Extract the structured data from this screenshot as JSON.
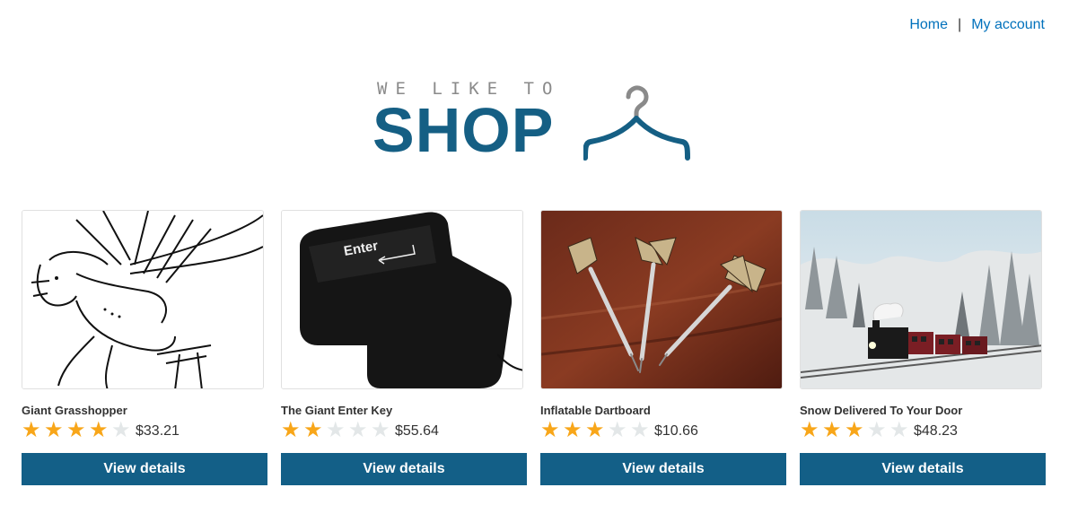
{
  "nav": {
    "home_label": "Home",
    "separator": "|",
    "account_label": "My account"
  },
  "logo": {
    "tagline": "WE LIKE TO",
    "wordmark": "SHOP",
    "icon": "hanger-icon"
  },
  "colors": {
    "brand": "#135f87",
    "link": "#0071bc",
    "star_on": "#f8a619",
    "star_off": "#e3e7e8"
  },
  "products": [
    {
      "name": "Giant Grasshopper",
      "rating": 4,
      "max_rating": 5,
      "price": "$33.21",
      "button_label": "View details",
      "image": "grasshopper-sketch"
    },
    {
      "name": "The Giant Enter Key",
      "rating": 2,
      "max_rating": 5,
      "price": "$55.64",
      "button_label": "View details",
      "image": "enter-key-cushion"
    },
    {
      "name": "Inflatable Dartboard",
      "rating": 3,
      "max_rating": 5,
      "price": "$10.66",
      "button_label": "View details",
      "image": "darts-on-table"
    },
    {
      "name": "Snow Delivered To Your Door",
      "rating": 3,
      "max_rating": 5,
      "price": "$48.23",
      "button_label": "View details",
      "image": "snowy-steam-train"
    }
  ],
  "images": {
    "enter_key_text": "Enter"
  }
}
